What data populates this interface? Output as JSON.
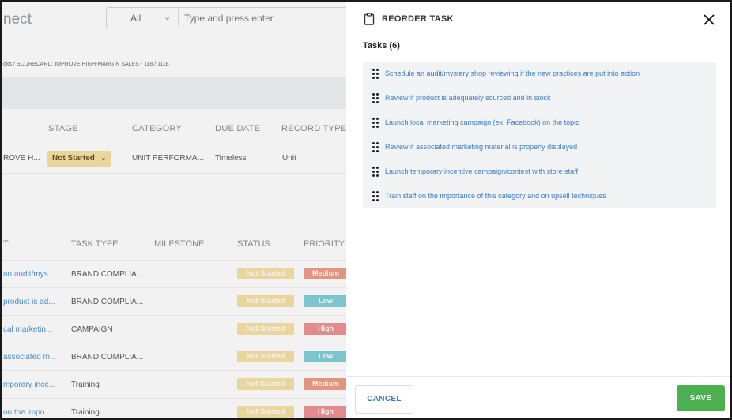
{
  "background": {
    "app_name": "nect",
    "search": {
      "scope": "All",
      "placeholder": "Type and press enter"
    },
    "breadcrumb": "oks / SCORECARD: IMPROVE HIGH-MARGIN SALES - 118 / 1118",
    "record_table": {
      "headers": {
        "stage": "STAGE",
        "category": "CATEGORY",
        "due_date": "DUE DATE",
        "record_type": "RECORD TYPE"
      },
      "row": {
        "name": "ROVE H...",
        "stage": "Not Started",
        "category": "UNIT PERFORMA...",
        "due_date": "Timeless",
        "record_type": "Unit"
      }
    },
    "task_table": {
      "headers": {
        "t": "T",
        "task_type": "TASK TYPE",
        "milestone": "MILESTONE",
        "status": "STATUS",
        "priority": "PRIORITY"
      },
      "rows": [
        {
          "name": "an audit/mys...",
          "type": "BRAND COMPLIA...",
          "status": "Not Started",
          "priority": "Medium",
          "priority_color": "#ee9a82"
        },
        {
          "name": "product is ad...",
          "type": "BRAND COMPLIA...",
          "status": "Not Started",
          "priority": "Low",
          "priority_color": "#7fcfd9"
        },
        {
          "name": "cal marketin...",
          "type": "CAMPAIGN",
          "status": "Not Started",
          "priority": "High",
          "priority_color": "#ef8f8f"
        },
        {
          "name": "associated m...",
          "type": "BRAND COMPLIA...",
          "status": "Not Started",
          "priority": "Low",
          "priority_color": "#7fcfd9"
        },
        {
          "name": "mporary ince...",
          "type": "Training",
          "status": "Not Started",
          "priority": "Medium",
          "priority_color": "#ee9a82"
        },
        {
          "name": "on the impo...",
          "type": "Training",
          "status": "Not Started",
          "priority": "High",
          "priority_color": "#ef8f8f"
        }
      ]
    }
  },
  "modal": {
    "title": "REORDER TASK",
    "subtitle": "Tasks (6)",
    "tasks": [
      "Schedule an audit/mystery shop reviewing if the new practices are put into action",
      "Review if product is adequately sourced and in stock",
      "Launch local marketing campaign (ex: Facebook) on the topic",
      "Review if associated marketing material is properly displayed",
      "Launch temporary incentive campaign/contest with store staff",
      "Train staff on the importance of this category and on upsell techniques"
    ],
    "cancel_label": "CANCEL",
    "save_label": "SAVE",
    "colors": {
      "accent": "#3a7cc6",
      "save": "#4caf50"
    }
  }
}
